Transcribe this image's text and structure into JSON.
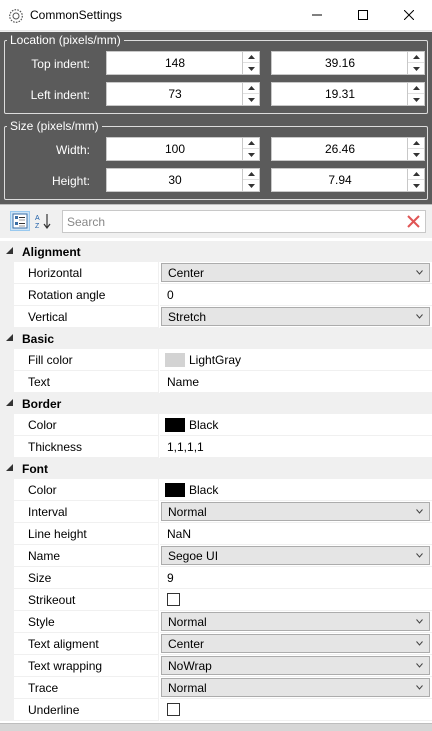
{
  "window": {
    "title": "CommonSettings"
  },
  "location": {
    "title": "Location (pixels/mm)",
    "rows": [
      {
        "label": "Top indent:",
        "pixels": "148",
        "mm": "39.16"
      },
      {
        "label": "Left indent:",
        "pixels": "73",
        "mm": "19.31"
      }
    ]
  },
  "size": {
    "title": "Size (pixels/mm)",
    "rows": [
      {
        "label": "Width:",
        "pixels": "100",
        "mm": "26.46"
      },
      {
        "label": "Height:",
        "pixels": "30",
        "mm": "7.94"
      }
    ]
  },
  "search": {
    "placeholder": "Search"
  },
  "categories": [
    {
      "title": "Alignment",
      "props": [
        {
          "name": "Horizontal",
          "value": "Center",
          "kind": "combo"
        },
        {
          "name": "Rotation angle",
          "value": "0",
          "kind": "text"
        },
        {
          "name": "Vertical",
          "value": "Stretch",
          "kind": "combo"
        }
      ]
    },
    {
      "title": "Basic",
      "props": [
        {
          "name": "Fill color",
          "value": "LightGray",
          "kind": "color",
          "color": "#d3d3d3"
        },
        {
          "name": "Text",
          "value": "Name",
          "kind": "text"
        }
      ]
    },
    {
      "title": "Border",
      "props": [
        {
          "name": "Color",
          "value": "Black",
          "kind": "color",
          "color": "#000000"
        },
        {
          "name": "Thickness",
          "value": "1,1,1,1",
          "kind": "text"
        }
      ]
    },
    {
      "title": "Font",
      "props": [
        {
          "name": "Color",
          "value": "Black",
          "kind": "color",
          "color": "#000000"
        },
        {
          "name": "Interval",
          "value": "Normal",
          "kind": "combo"
        },
        {
          "name": "Line height",
          "value": "NaN",
          "kind": "text"
        },
        {
          "name": "Name",
          "value": "Segoe UI",
          "kind": "combo"
        },
        {
          "name": "Size",
          "value": "9",
          "kind": "text"
        },
        {
          "name": "Strikeout",
          "value": "",
          "kind": "check"
        },
        {
          "name": "Style",
          "value": "Normal",
          "kind": "combo"
        },
        {
          "name": "Text aligment",
          "value": "Center",
          "kind": "combo"
        },
        {
          "name": "Text wrapping",
          "value": "NoWrap",
          "kind": "combo"
        },
        {
          "name": "Trace",
          "value": "Normal",
          "kind": "combo"
        },
        {
          "name": "Underline",
          "value": "",
          "kind": "check"
        }
      ]
    }
  ]
}
